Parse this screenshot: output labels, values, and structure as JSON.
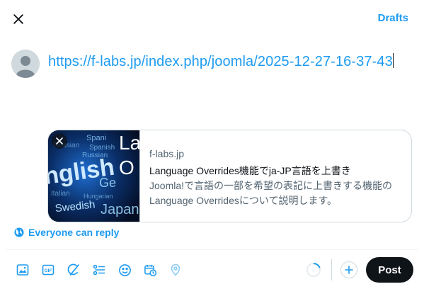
{
  "header": {
    "drafts_label": "Drafts"
  },
  "composer": {
    "text": "https://f-labs.jp/index.php/joomla/2025-12-27-16-37-43"
  },
  "link_card": {
    "domain": "f-labs.jp",
    "title": "Language Overrides機能でja-JP言語を上書き",
    "description": "Joomla!で言語の一部を希望の表記に上書きする機能のLanguage Overridesについて説明します。"
  },
  "reply_setting": {
    "label": "Everyone can reply"
  },
  "toolbar": {
    "items": [
      "image-icon",
      "gif-icon",
      "grok-icon",
      "poll-icon",
      "emoji-icon",
      "schedule-icon",
      "location-icon"
    ]
  },
  "post_button": {
    "label": "Post"
  },
  "colors": {
    "accent": "#1d9bf0",
    "text": "#0f1419",
    "secondary": "#536471",
    "border": "#cfd9de"
  }
}
